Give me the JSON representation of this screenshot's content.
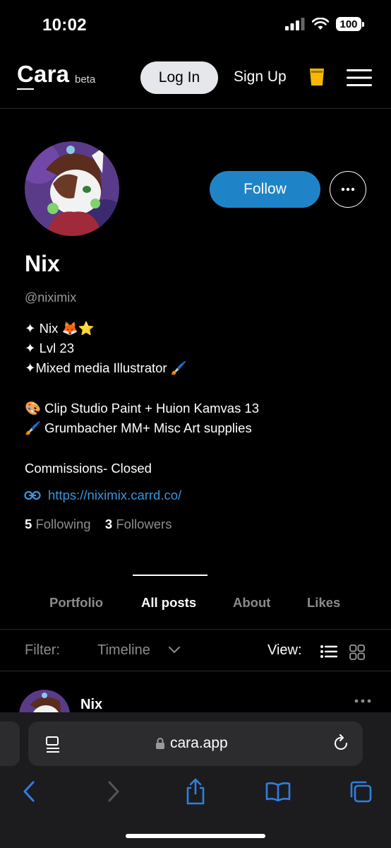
{
  "status_bar": {
    "time": "10:02",
    "battery": "100"
  },
  "header": {
    "logo": "Cara",
    "beta": "beta",
    "login_label": "Log In",
    "signup_label": "Sign Up"
  },
  "profile": {
    "follow_label": "Follow",
    "name": "Nix",
    "handle": "@niximix",
    "bio": [
      "✦ Nix 🦊⭐",
      "✦ Lvl 23",
      "✦Mixed media Illustrator 🖌️",
      "🎨 Clip Studio Paint + Huion Kamvas 13",
      "🖌️ Grumbacher MM+ Misc Art supplies",
      "Commissions- Closed"
    ],
    "link": "https://niximix.carrd.co/",
    "following_count": "5",
    "following_label": "Following",
    "followers_count": "3",
    "followers_label": "Followers"
  },
  "tabs": [
    {
      "label": "Portfolio",
      "active": false
    },
    {
      "label": "All posts",
      "active": true
    },
    {
      "label": "About",
      "active": false
    },
    {
      "label": "Likes",
      "active": false
    }
  ],
  "filter": {
    "label": "Filter:",
    "value": "Timeline",
    "view_label": "View:"
  },
  "post": {
    "author": "Nix"
  },
  "browser": {
    "url": "cara.app"
  },
  "colors": {
    "accent": "#1f84c7",
    "link": "#3a95d8",
    "cup": "#f5b800",
    "background": "#000000"
  }
}
